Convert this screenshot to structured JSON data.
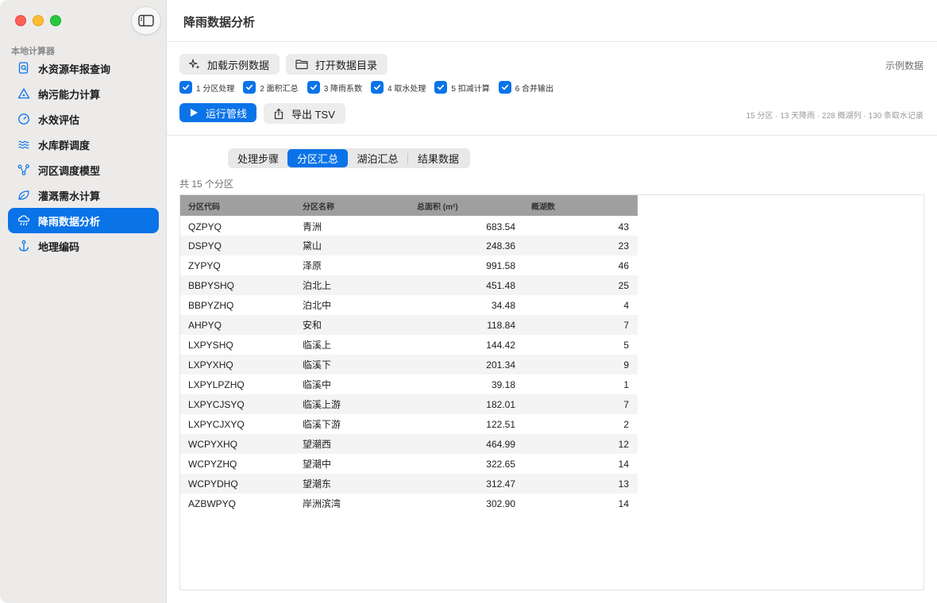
{
  "sidebar": {
    "section_title": "本地计算器",
    "items": [
      {
        "label": "水资源年报查询",
        "icon": "document-search-icon"
      },
      {
        "label": "纳污能力计算",
        "icon": "warning-triangle-icon"
      },
      {
        "label": "水效评估",
        "icon": "gauge-icon"
      },
      {
        "label": "水库群调度",
        "icon": "waves-icon"
      },
      {
        "label": "河区调度模型",
        "icon": "network-icon"
      },
      {
        "label": "灌溉需水计算",
        "icon": "leaf-icon"
      },
      {
        "label": "降雨数据分析",
        "icon": "rain-icon",
        "active": true
      },
      {
        "label": "地理编码",
        "icon": "anchor-icon"
      }
    ]
  },
  "header": {
    "title": "降雨数据分析"
  },
  "toolbar": {
    "load_label": "加载示例数据",
    "open_label": "打开数据目录",
    "example_label": "示例数据",
    "run_label": "运行管线",
    "export_label": "导出 TSV",
    "stats": "15 分区 · 13 天降雨 · 228 概湖列 · 130 条取水记录",
    "steps": [
      {
        "label": "1 分区处理",
        "checked": true
      },
      {
        "label": "2 面积汇总",
        "checked": true
      },
      {
        "label": "3 降雨系数",
        "checked": true
      },
      {
        "label": "4 取水处理",
        "checked": true
      },
      {
        "label": "5 扣减计算",
        "checked": true
      },
      {
        "label": "6 合并输出",
        "checked": true
      }
    ]
  },
  "tabs": [
    {
      "label": "处理步骤"
    },
    {
      "label": "分区汇总",
      "active": true
    },
    {
      "label": "湖泊汇总"
    },
    {
      "label": "结果数据"
    }
  ],
  "count_label": "共 15 个分区",
  "table": {
    "columns": [
      "分区代码",
      "分区名称",
      "总面积 (m²)",
      "概湖数"
    ],
    "rows": [
      [
        "QZPYQ",
        "青洲",
        "683.54",
        "43"
      ],
      [
        "DSPYQ",
        "黛山",
        "248.36",
        "23"
      ],
      [
        "ZYPYQ",
        "泽原",
        "991.58",
        "46"
      ],
      [
        "BBPYSHQ",
        "泊北上",
        "451.48",
        "25"
      ],
      [
        "BBPYZHQ",
        "泊北中",
        "34.48",
        "4"
      ],
      [
        "AHPYQ",
        "安和",
        "118.84",
        "7"
      ],
      [
        "LXPYSHQ",
        "临溪上",
        "144.42",
        "5"
      ],
      [
        "LXPYXHQ",
        "临溪下",
        "201.34",
        "9"
      ],
      [
        "LXPYLPZHQ",
        "临溪中",
        "39.18",
        "1"
      ],
      [
        "LXPYCJSYQ",
        "临溪上游",
        "182.01",
        "7"
      ],
      [
        "LXPYCJXYQ",
        "临溪下游",
        "122.51",
        "2"
      ],
      [
        "WCPYXHQ",
        "望潮西",
        "464.99",
        "12"
      ],
      [
        "WCPYZHQ",
        "望潮中",
        "322.65",
        "14"
      ],
      [
        "WCPYDHQ",
        "望潮东",
        "312.47",
        "13"
      ],
      [
        "AZBWPYQ",
        "岸洲滨湾",
        "302.90",
        "14"
      ]
    ]
  },
  "colors": {
    "accent": "#0a73e8",
    "sidebar_bg": "#ecebea"
  }
}
